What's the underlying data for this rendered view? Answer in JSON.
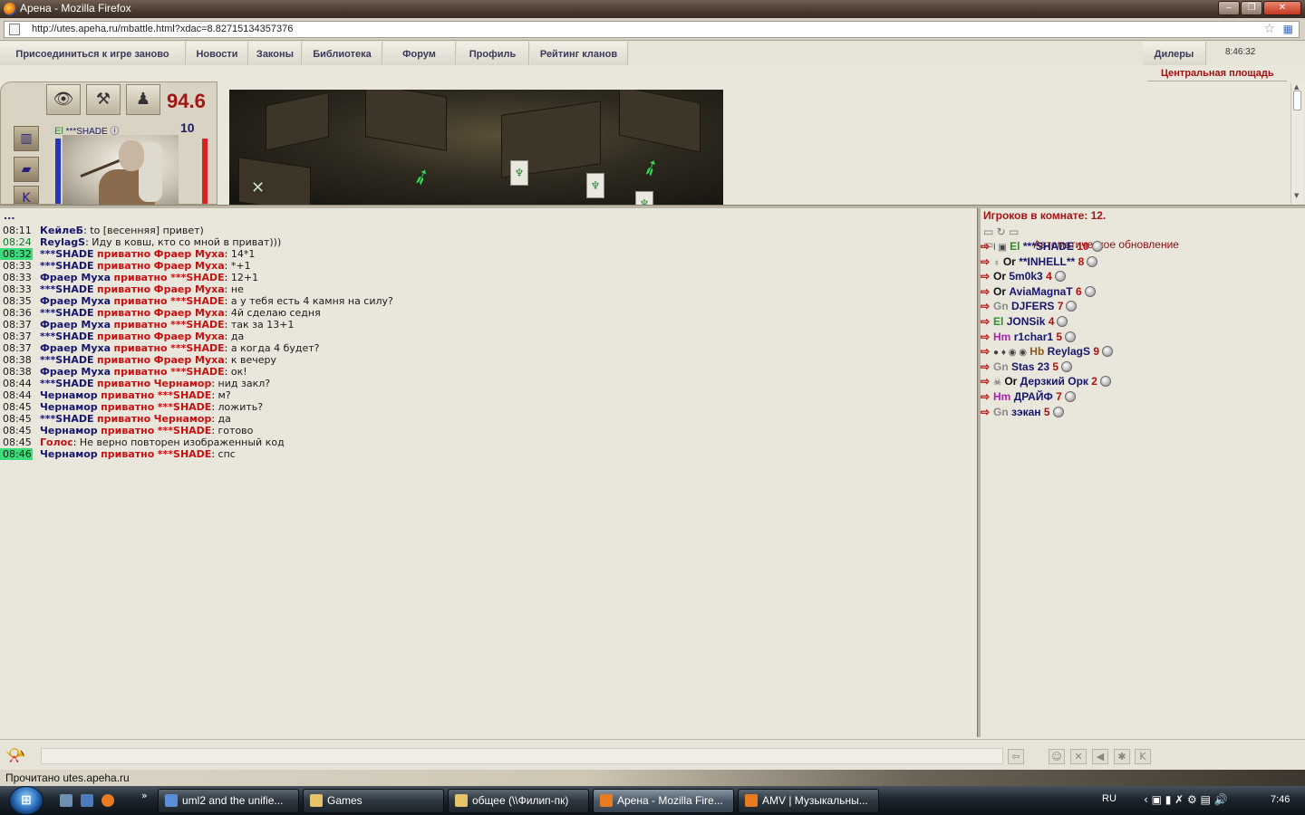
{
  "window": {
    "title": "Арена - Mozilla Firefox",
    "min": "‒",
    "max": "❐",
    "close": "✕"
  },
  "browser": {
    "url": "http://utes.apeha.ru/mbattle.html?xdac=8.82715134357376",
    "status": "Прочитано utes.apeha.ru"
  },
  "nav": {
    "items": [
      "Присоединиться к игре заново",
      "Новости",
      "Законы",
      "Библиотека",
      "Форум",
      "Профиль",
      "Рейтинг кланов",
      "Дилеры"
    ],
    "clock": "8:46:32",
    "location": "Центральная площадь"
  },
  "character": {
    "race": "El",
    "name": "***SHADE",
    "level": "10",
    "hp": "94.6",
    "buttons": [
      "eye-icon",
      "tools-icon",
      "wizard-icon"
    ]
  },
  "chat": {
    "more": "...",
    "messages": [
      {
        "time": "08:11",
        "highlight": false,
        "from": "КейлеБ",
        "private": "",
        "to": "",
        "text": "to [весенняя] привет)"
      },
      {
        "time": "08:24",
        "highlight": false,
        "from": "ReylagS",
        "private": "",
        "to": "",
        "text": "Иду в ковш, кто со мной в приват)))"
      },
      {
        "time": "08:32",
        "highlight": true,
        "from": "***SHADE",
        "private": "приватно",
        "to": "Фраер Муха",
        "text": "14*1"
      },
      {
        "time": "08:33",
        "highlight": false,
        "from": "***SHADE",
        "private": "приватно",
        "to": "Фраер Муха",
        "text": "*+1"
      },
      {
        "time": "08:33",
        "highlight": false,
        "from": "Фраер Муха",
        "private": "приватно",
        "to": "***SHADE",
        "text": "12+1"
      },
      {
        "time": "08:33",
        "highlight": false,
        "from": "***SHADE",
        "private": "приватно",
        "to": "Фраер Муха",
        "text": "не"
      },
      {
        "time": "08:35",
        "highlight": false,
        "from": "Фраер Муха",
        "private": "приватно",
        "to": "***SHADE",
        "text": "а у тебя есть 4 камня на силу?"
      },
      {
        "time": "08:36",
        "highlight": false,
        "from": "***SHADE",
        "private": "приватно",
        "to": "Фраер Муха",
        "text": "4й сделаю седня"
      },
      {
        "time": "08:37",
        "highlight": false,
        "from": "Фраер Муха",
        "private": "приватно",
        "to": "***SHADE",
        "text": "так за 13+1"
      },
      {
        "time": "08:37",
        "highlight": false,
        "from": "***SHADE",
        "private": "приватно",
        "to": "Фраер Муха",
        "text": "да"
      },
      {
        "time": "08:37",
        "highlight": false,
        "from": "Фраер Муха",
        "private": "приватно",
        "to": "***SHADE",
        "text": "а когда 4 будет?"
      },
      {
        "time": "08:38",
        "highlight": false,
        "from": "***SHADE",
        "private": "приватно",
        "to": "Фраер Муха",
        "text": "к вечеру"
      },
      {
        "time": "08:38",
        "highlight": false,
        "from": "Фраер Муха",
        "private": "приватно",
        "to": "***SHADE",
        "text": "ок!"
      },
      {
        "time": "08:44",
        "highlight": false,
        "from": "***SHADE",
        "private": "приватно",
        "to": "Чернамор",
        "text": "нид закл?"
      },
      {
        "time": "08:44",
        "highlight": false,
        "from": "Чернамор",
        "private": "приватно",
        "to": "***SHADE",
        "text": "м?"
      },
      {
        "time": "08:45",
        "highlight": false,
        "from": "Чернамор",
        "private": "приватно",
        "to": "***SHADE",
        "text": "ложить?"
      },
      {
        "time": "08:45",
        "highlight": false,
        "from": "***SHADE",
        "private": "приватно",
        "to": "Чернамор",
        "text": "да"
      },
      {
        "time": "08:45",
        "highlight": false,
        "from": "Чернамор",
        "private": "приватно",
        "to": "***SHADE",
        "text": "готово"
      },
      {
        "time": "08:45",
        "highlight": false,
        "from": "Голос",
        "private": "",
        "to": "",
        "text": "Не верно повторен изображенный код",
        "system": true
      },
      {
        "time": "08:46",
        "highlight": true,
        "from": "Чернамор",
        "private": "приватно",
        "to": "***SHADE",
        "text": "спс"
      }
    ]
  },
  "players": {
    "header": "Игроков в комнате: 12.",
    "auto_update": "Автоматическое обновление",
    "list": [
      {
        "icons": "ǀ ▣",
        "race": "El",
        "race_color": "#2b8f2b",
        "name": "***SHADE",
        "level": "10"
      },
      {
        "icons": "♁",
        "race": "Or",
        "race_color": "#111111",
        "name": "**INHELL**",
        "level": "8"
      },
      {
        "icons": "",
        "race": "Or",
        "race_color": "#111111",
        "name": "5m0k3",
        "level": "4"
      },
      {
        "icons": "",
        "race": "Or",
        "race_color": "#111111",
        "name": "AviaMagnaT",
        "level": "6"
      },
      {
        "icons": "",
        "race": "Gn",
        "race_color": "#8a8a8a",
        "name": "DJFERS",
        "level": "7"
      },
      {
        "icons": "",
        "race": "El",
        "race_color": "#2b8f2b",
        "name": "JONSik",
        "level": "4"
      },
      {
        "icons": "",
        "race": "Hm",
        "race_color": "#b020b0",
        "name": "r1char1",
        "level": "5"
      },
      {
        "icons": "● ♦ ◉ ◉",
        "race": "Hb",
        "race_color": "#8a5a1a",
        "name": "ReylagS",
        "level": "9"
      },
      {
        "icons": "",
        "race": "Gn",
        "race_color": "#8a8a8a",
        "name": "Stas 23",
        "level": "5"
      },
      {
        "icons": "☠",
        "race": "Or",
        "race_color": "#111111",
        "name": "Дерзкий Орк",
        "level": "2"
      },
      {
        "icons": "",
        "race": "Hm",
        "race_color": "#b020b0",
        "name": "ДРАЙФ",
        "level": "7"
      },
      {
        "icons": "",
        "race": "Gn",
        "race_color": "#8a8a8a",
        "name": "зэкан",
        "level": "5"
      }
    ]
  },
  "input_buttons": [
    "⇦",
    "☺",
    "✕",
    "◀",
    "✱",
    "K"
  ],
  "taskbar": {
    "tasks": [
      {
        "label": "uml2 and the unifie...",
        "icon": "#5a8fd8",
        "active": false
      },
      {
        "label": "Games",
        "icon": "#e6c36a",
        "active": false
      },
      {
        "label": "общее (\\\\Филип-пк)",
        "icon": "#e6c36a",
        "active": false
      },
      {
        "label": "Арена - Mozilla Fire...",
        "icon": "#e87a20",
        "active": true
      },
      {
        "label": "AMV | Музыкальны...",
        "icon": "#e87a20",
        "active": false
      }
    ],
    "lang": "RU",
    "clock": "7:46"
  }
}
